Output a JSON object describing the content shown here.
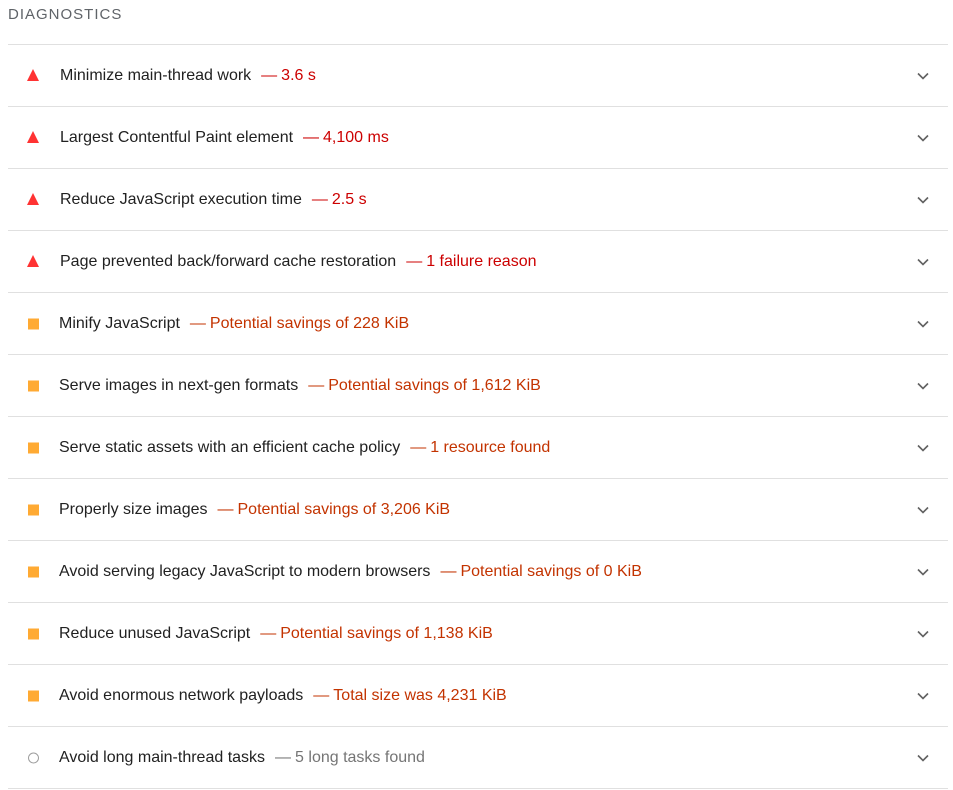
{
  "section_title": "DIAGNOSTICS",
  "separator": "—",
  "colors": {
    "fail": "#cc0000",
    "fail_icon": "#ff3333",
    "warn": "#c33300",
    "warn_icon": "#ffaa33",
    "info": "#757575"
  },
  "audits": [
    {
      "title": "Minimize main-thread work",
      "detail": "3.6 s",
      "severity": "fail",
      "icon": "triangle-fail-icon"
    },
    {
      "title": "Largest Contentful Paint element",
      "detail": "4,100 ms",
      "severity": "fail",
      "icon": "triangle-fail-icon"
    },
    {
      "title": "Reduce JavaScript execution time",
      "detail": "2.5 s",
      "severity": "fail",
      "icon": "triangle-fail-icon"
    },
    {
      "title": "Page prevented back/forward cache restoration",
      "detail": "1 failure reason",
      "severity": "fail",
      "icon": "triangle-fail-icon"
    },
    {
      "title": "Minify JavaScript",
      "detail": "Potential savings of 228 KiB",
      "severity": "warn",
      "icon": "square-warn-icon"
    },
    {
      "title": "Serve images in next-gen formats",
      "detail": "Potential savings of 1,612 KiB",
      "severity": "warn",
      "icon": "square-warn-icon"
    },
    {
      "title": "Serve static assets with an efficient cache policy",
      "detail": "1 resource found",
      "severity": "warn",
      "icon": "square-warn-icon"
    },
    {
      "title": "Properly size images",
      "detail": "Potential savings of 3,206 KiB",
      "severity": "warn",
      "icon": "square-warn-icon"
    },
    {
      "title": "Avoid serving legacy JavaScript to modern browsers",
      "detail": "Potential savings of 0 KiB",
      "severity": "warn",
      "icon": "square-warn-icon"
    },
    {
      "title": "Reduce unused JavaScript",
      "detail": "Potential savings of 1,138 KiB",
      "severity": "warn",
      "icon": "square-warn-icon"
    },
    {
      "title": "Avoid enormous network payloads",
      "detail": "Total size was 4,231 KiB",
      "severity": "warn",
      "icon": "square-warn-icon"
    },
    {
      "title": "Avoid long main-thread tasks",
      "detail": "5 long tasks found",
      "severity": "info",
      "icon": "circle-info-icon"
    }
  ]
}
